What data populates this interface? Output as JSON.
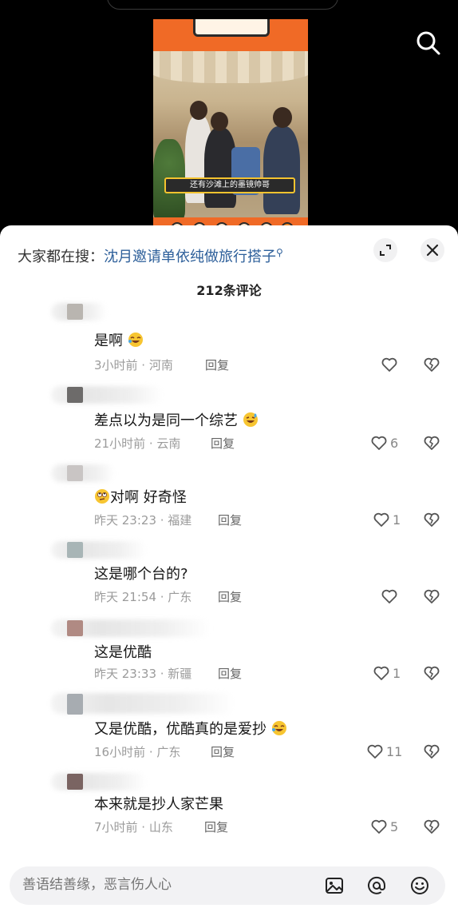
{
  "thumbnail": {
    "caption": "还有沙滩上的墨镜帅哥"
  },
  "search_hint": {
    "prefix": "大家都在搜：",
    "query": "沈月邀请单依纯做旅行搭子",
    "icon": "search-icon"
  },
  "comment_count_label": "212条评论",
  "comments": [
    {
      "text": "是啊",
      "emoji": "laughing-crying-emoji",
      "meta": "3小时前 · 河南",
      "reply": "回复",
      "likes": "",
      "avatar_color": "#b9b5b0"
    },
    {
      "text": "差点以为是同一个综艺",
      "emoji": "sweat-laugh-emoji",
      "meta": "21小时前 · 云南",
      "reply": "回复",
      "likes": "6",
      "avatar_color": "#6d6b6a"
    },
    {
      "text_prefix_emoji": "eye-roll-emoji",
      "text": "对啊 好奇怪",
      "meta": "昨天 23:23 · 福建",
      "reply": "回复",
      "likes": "1",
      "avatar_color": "#c9c5c4"
    },
    {
      "text": "这是哪个台的?",
      "meta": "昨天 21:54 · 广东",
      "reply": "回复",
      "likes": "",
      "avatar_color": "#a8b5b6"
    },
    {
      "text": "这是优酷",
      "meta": "昨天 23:33 · 新疆",
      "reply": "回复",
      "likes": "1",
      "avatar_color": "#b08a83"
    },
    {
      "text": "又是优酷，优酷真的是爱抄",
      "emoji": "laughing-crying-emoji",
      "meta": "16小时前 · 广东",
      "reply": "回复",
      "likes": "11",
      "avatar_color": "#a7acb1"
    },
    {
      "text": "本来就是抄人家芒果",
      "meta": "7小时前 · 山东",
      "reply": "回复",
      "likes": "5",
      "avatar_color": "#7a6462"
    }
  ],
  "input": {
    "placeholder": "善语结善缘，恶言伤人心"
  },
  "colors": {
    "link_blue": "#2d5f9a",
    "thumbnail_orange": "#f06a26",
    "meta_gray": "#9b9b9b"
  },
  "icons": [
    "search-icon",
    "expand-icon",
    "close-icon",
    "heart-icon",
    "broken-heart-icon",
    "image-icon",
    "at-icon",
    "smile-icon"
  ]
}
